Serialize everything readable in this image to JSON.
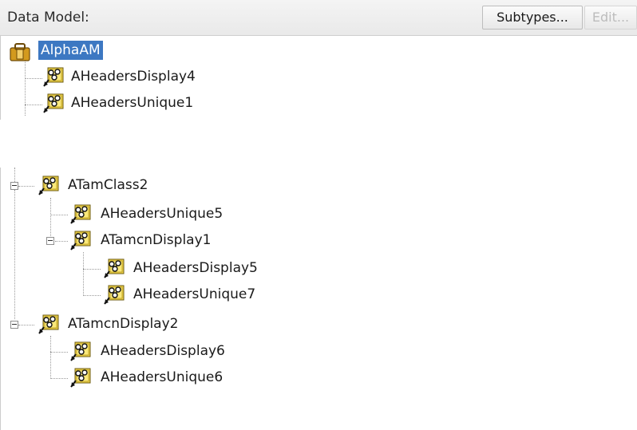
{
  "header": {
    "title": "Data Model:",
    "subtypes_label": "Subtypes...",
    "edit_label": "Edit..."
  },
  "tree_top": {
    "root_label": "AlphaAM",
    "children": [
      "AHeadersDisplay4",
      "AHeadersUnique1"
    ]
  },
  "tree_bottom": {
    "nodes": [
      "ATamClass2",
      "AHeadersUnique5",
      "ATamcnDisplay1",
      "AHeadersDisplay5",
      "AHeadersUnique7",
      "ATamcnDisplay2",
      "AHeadersDisplay6",
      "AHeadersUnique6"
    ]
  },
  "colors": {
    "selection": "#3d78c2",
    "header_bg": "#ececec",
    "disabled_text": "#bcbcbc"
  }
}
